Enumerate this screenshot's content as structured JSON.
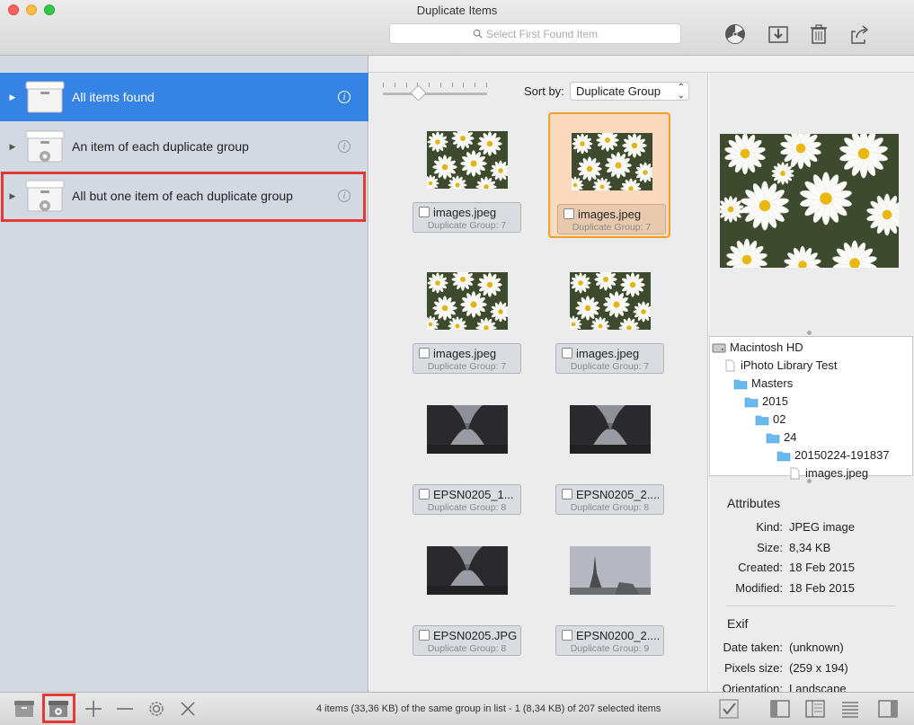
{
  "window": {
    "title": "Duplicate Items"
  },
  "toolbar": {
    "search_placeholder": "Select First Found Item",
    "icons": [
      "radiation-icon",
      "import-icon",
      "trash-icon",
      "share-icon"
    ]
  },
  "sidebar": {
    "items": [
      {
        "label": "All items found",
        "selected": true
      },
      {
        "label": "An item of each duplicate group",
        "selected": false
      },
      {
        "label": "All but one item of each duplicate group",
        "selected": false,
        "highlighted": true
      }
    ]
  },
  "grid": {
    "sort_label": "Sort by:",
    "sort_value": "Duplicate Group",
    "items": [
      {
        "name": "images.jpeg",
        "group": "Duplicate Group: 7",
        "type": "daisy",
        "selected": false
      },
      {
        "name": "images.jpeg",
        "group": "Duplicate Group: 7",
        "type": "daisy",
        "selected": true
      },
      {
        "name": "images.jpeg",
        "group": "Duplicate Group: 7",
        "type": "daisy",
        "selected": false
      },
      {
        "name": "images.jpeg",
        "group": "Duplicate Group: 7",
        "type": "daisy",
        "selected": false
      },
      {
        "name": "EPSN0205_1...",
        "group": "Duplicate Group: 8",
        "type": "eiffel",
        "selected": false
      },
      {
        "name": "EPSN0205_2....",
        "group": "Duplicate Group: 8",
        "type": "eiffel",
        "selected": false
      },
      {
        "name": "EPSN0205.JPG",
        "group": "Duplicate Group: 8",
        "type": "eiffel",
        "selected": false
      },
      {
        "name": "EPSN0200_2....",
        "group": "Duplicate Group: 9",
        "type": "tower",
        "selected": false
      }
    ]
  },
  "path": [
    {
      "label": "Macintosh HD",
      "kind": "disk"
    },
    {
      "label": "iPhoto Library Test",
      "kind": "file"
    },
    {
      "label": "Masters",
      "kind": "folder"
    },
    {
      "label": "2015",
      "kind": "folder"
    },
    {
      "label": "02",
      "kind": "folder"
    },
    {
      "label": "24",
      "kind": "folder"
    },
    {
      "label": "20150224-191837",
      "kind": "folder"
    },
    {
      "label": "images.jpeg",
      "kind": "file"
    }
  ],
  "attributes": {
    "heading": "Attributes",
    "rows": [
      {
        "key": "Kind:",
        "value": "JPEG image"
      },
      {
        "key": "Size:",
        "value": "8,34 KB"
      },
      {
        "key": "Created:",
        "value": "18 Feb 2015"
      },
      {
        "key": "Modified:",
        "value": "18 Feb 2015"
      }
    ]
  },
  "exif": {
    "heading": "Exif",
    "rows": [
      {
        "key": "Date taken:",
        "value": "(unknown)"
      },
      {
        "key": "Pixels size:",
        "value": "(259 x 194)"
      },
      {
        "key": "Orientation:",
        "value": "Landscape"
      }
    ]
  },
  "status": {
    "text": "4 items (33,36 KB) of the same group in list - 1 (8,34 KB) of 207 selected items"
  },
  "colors": {
    "accent": "#3583e5",
    "highlight": "#e53935",
    "selected_cell": "#fbd9bc"
  }
}
